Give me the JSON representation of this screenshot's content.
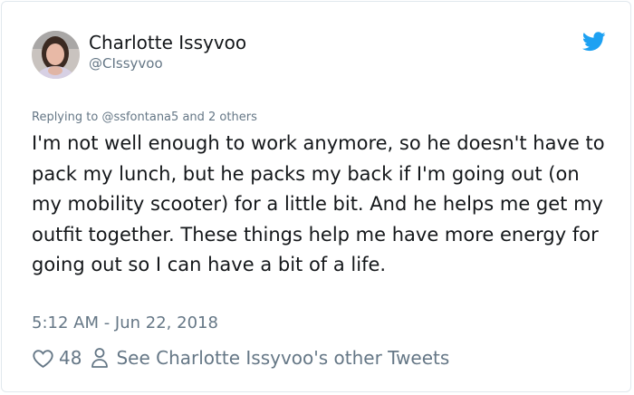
{
  "user": {
    "display_name": "Charlotte Issyvoo",
    "handle": "@CIssyvoo"
  },
  "reply": {
    "prefix": "Replying to",
    "mention": "@ssfontana5",
    "suffix": "and 2 others"
  },
  "tweet": {
    "text": "I'm not well enough to work anymore, so he doesn't have to pack my lunch, but he packs my back if I'm going out (on my mobility scooter) for a little bit. And he helps me get my outfit together. These things help me have more energy for going out so I can have a bit of a life.",
    "timestamp": "5:12 AM - Jun 22, 2018"
  },
  "actions": {
    "like_count": "48",
    "other_tweets_label": "See Charlotte Issyvoo's other Tweets"
  },
  "icons": {
    "brand": "twitter-bird-icon",
    "like": "heart-icon",
    "profile": "person-icon"
  },
  "colors": {
    "twitter_blue": "#1da1f2",
    "text": "#14171a",
    "muted": "#657786"
  }
}
